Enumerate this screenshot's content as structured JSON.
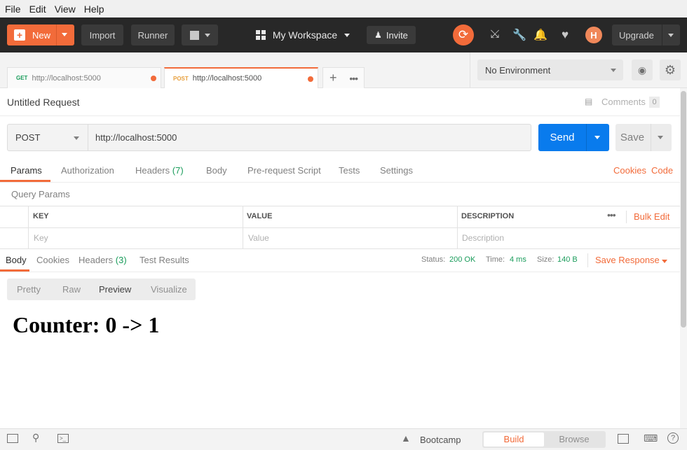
{
  "menubar": [
    "File",
    "Edit",
    "View",
    "Help"
  ],
  "header": {
    "new_label": "New",
    "import_label": "Import",
    "runner_label": "Runner",
    "workspace_label": "My Workspace",
    "invite_label": "Invite",
    "avatar_initial": "H",
    "upgrade_label": "Upgrade"
  },
  "tabs": [
    {
      "method": "GET",
      "url": "http://localhost:5000",
      "method_color": "#1a9c5b"
    },
    {
      "method": "POST",
      "url": "http://localhost:5000",
      "method_color": "#e8a03e"
    }
  ],
  "environment": {
    "selected": "No Environment"
  },
  "request": {
    "title": "Untitled Request",
    "comments_label": "Comments",
    "comments_count": "0",
    "method": "POST",
    "url": "http://localhost:5000",
    "send_label": "Send",
    "save_label": "Save"
  },
  "request_tabs": {
    "params": "Params",
    "authorization": "Authorization",
    "headers": "Headers",
    "headers_count": "(7)",
    "body": "Body",
    "prerequest": "Pre-request Script",
    "tests": "Tests",
    "settings": "Settings",
    "cookies": "Cookies",
    "code": "Code"
  },
  "params": {
    "section_label": "Query Params",
    "col_key": "KEY",
    "col_value": "VALUE",
    "col_description": "DESCRIPTION",
    "bulk_edit": "Bulk Edit",
    "key_placeholder": "Key",
    "value_placeholder": "Value",
    "description_placeholder": "Description"
  },
  "response": {
    "tab_body": "Body",
    "tab_cookies": "Cookies",
    "tab_headers": "Headers",
    "headers_count": "(3)",
    "tab_tests": "Test Results",
    "status_label": "Status:",
    "status_value": "200 OK",
    "time_label": "Time:",
    "time_value": "4 ms",
    "size_label": "Size:",
    "size_value": "140 B",
    "save_response": "Save Response",
    "view_modes": [
      "Pretty",
      "Raw",
      "Preview",
      "Visualize"
    ],
    "preview_heading": "Counter: 0 -> 1"
  },
  "footer": {
    "bootcamp": "Bootcamp",
    "build": "Build",
    "browse": "Browse"
  },
  "colors": {
    "accent": "#f26b3a",
    "send": "#097bed",
    "ok": "#1a9c5b"
  }
}
